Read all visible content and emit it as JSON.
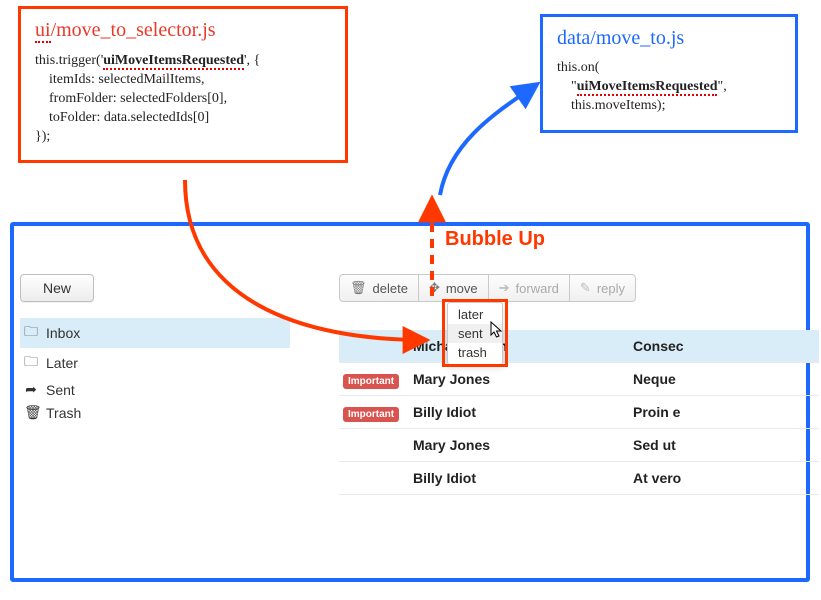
{
  "left_box": {
    "title_prefix": "ui",
    "title_rest": "/move_to_selector.js",
    "code_line1_pre": "this.trigger('",
    "code_line1_bold": "uiMoveItemsRequested",
    "code_line1_post": "', {",
    "code_line2": "    itemIds: selectedMailItems,",
    "code_line3": "    fromFolder: selectedFolders[0],",
    "code_line4": "    toFolder: data.selectedIds[0]",
    "code_line5": "});"
  },
  "right_box": {
    "title": "data/move_to.js",
    "code_line1": "this.on(",
    "code_line2_pre": "    \"",
    "code_line2_bold": "uiMoveItemsRequested",
    "code_line2_post": "\",",
    "code_line3": "    this.moveItems);"
  },
  "bubble_label": "Bubble Up",
  "sidebar": {
    "new_button": "New",
    "folders": [
      {
        "icon": "folder",
        "label": "Inbox",
        "selected": true
      },
      {
        "icon": "folder",
        "label": "Later",
        "selected": false
      },
      {
        "icon": "send",
        "label": "Sent",
        "selected": false
      },
      {
        "icon": "trash",
        "label": "Trash",
        "selected": false
      }
    ]
  },
  "toolbar": {
    "delete": "delete",
    "move": "move",
    "forward": "forward",
    "reply": "reply"
  },
  "move_dropdown": {
    "options": [
      "later",
      "sent",
      "trash"
    ],
    "hover_index": 1
  },
  "mail": [
    {
      "important": false,
      "sender": "Michael Smith",
      "subject": "Consec",
      "selected": true
    },
    {
      "important": true,
      "sender": "Mary Jones",
      "subject": "Neque ",
      "selected": false
    },
    {
      "important": true,
      "sender": "Billy Idiot",
      "subject": "Proin e",
      "selected": false
    },
    {
      "important": false,
      "sender": "Mary Jones",
      "subject": "Sed ut ",
      "selected": false
    },
    {
      "important": false,
      "sender": "Billy Idiot",
      "subject": "At vero",
      "selected": false
    }
  ],
  "important_tag": "Important"
}
